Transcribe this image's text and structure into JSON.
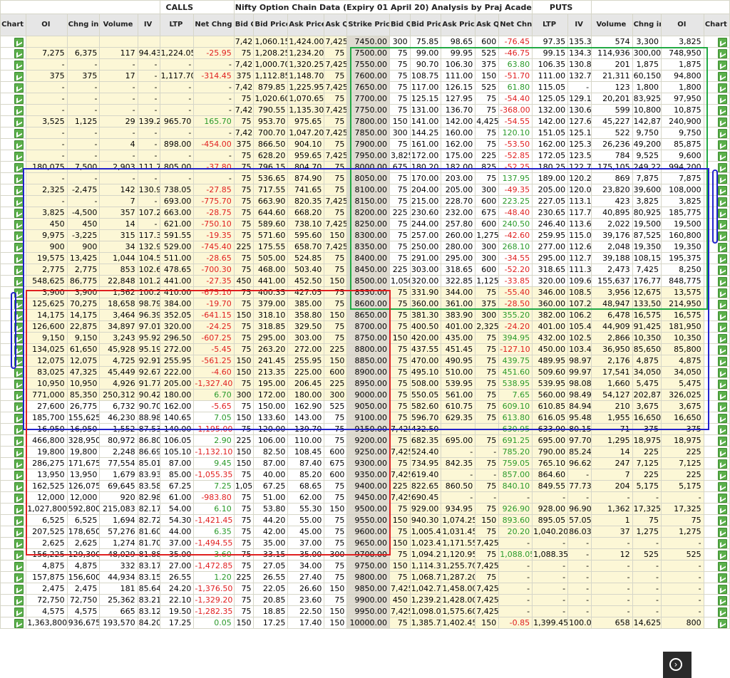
{
  "header": {
    "calls_label": "CALLS",
    "puts_label": "PUTS",
    "title": "Nifty Option Chain Data (Expiry 01 April 20) Analysis by Praj Academy EOD 27 03 2020"
  },
  "columns": [
    "Chart",
    "OI",
    "Chng in OI",
    "Volume",
    "IV",
    "LTP",
    "Net Chng",
    "Bid Qty",
    "Bid Price",
    "Ask Price",
    "Ask Qty",
    "Strike Price",
    "Bid Qty",
    "Bid Price",
    "Ask Price",
    "Ask Qty",
    "Net Chng",
    "LTP",
    "IV",
    "Volume",
    "Chng in OI",
    "OI",
    "Chart"
  ],
  "chart_icon": "chart-icon",
  "colors": {
    "itm_bg": "#fcf7d6",
    "strike_bg": "#dfdbd1",
    "negative": "#e02020",
    "positive": "#2a9a2a",
    "green_box": "#22aa44",
    "blue_box": "#2222cc",
    "red_box": "#e02020"
  },
  "rows": [
    [
      "",
      "",
      "",
      "",
      "",
      "",
      "7,425",
      "1,060.15",
      "1,424.00",
      "7,425",
      "7450.00",
      "300",
      "75.85",
      "98.65",
      "600",
      "-76.45",
      "97.35",
      "135.31",
      "574",
      "3,300",
      "3,825"
    ],
    [
      "7,275",
      "6,375",
      "117",
      "94.43",
      "1,224.05",
      "-25.95",
      "75",
      "1,208.25",
      "1,234.20",
      "75",
      "7500.00",
      "75",
      "99.00",
      "99.95",
      "525",
      "-46.75",
      "99.15",
      "134.30",
      "114,936",
      "300,000",
      "748,950"
    ],
    [
      "-",
      "-",
      "-",
      "-",
      "-",
      "-",
      "7,425",
      "1,000.70",
      "1,320.25",
      "7,425",
      "7550.00",
      "75",
      "90.70",
      "106.30",
      "375",
      "63.80",
      "106.35",
      "130.83",
      "201",
      "1,875",
      "1,875"
    ],
    [
      "375",
      "375",
      "17",
      "-",
      "1,117.70",
      "-314.45",
      "375",
      "1,112.85",
      "1,148.70",
      "75",
      "7600.00",
      "75",
      "108.75",
      "111.00",
      "150",
      "-51.70",
      "111.00",
      "132.72",
      "21,311",
      "60,150",
      "94,800"
    ],
    [
      "-",
      "-",
      "-",
      "-",
      "-",
      "-",
      "7,425",
      "879.85",
      "1,225.95",
      "7,425",
      "7650.00",
      "75",
      "117.00",
      "126.15",
      "525",
      "61.80",
      "115.05",
      "-",
      "123",
      "1,800",
      "1,800"
    ],
    [
      "-",
      "-",
      "-",
      "-",
      "-",
      "-",
      "75",
      "1,020.60",
      "1,070.65",
      "75",
      "7700.00",
      "75",
      "125.15",
      "127.95",
      "75",
      "-54.40",
      "125.05",
      "129.17",
      "20,201",
      "83,925",
      "97,950"
    ],
    [
      "-",
      "-",
      "-",
      "-",
      "-",
      "-",
      "7,425",
      "790.55",
      "1,135.30",
      "7,425",
      "7750.00",
      "75",
      "131.00",
      "136.70",
      "75",
      "-368.00",
      "132.00",
      "130.61",
      "599",
      "10,800",
      "10,875"
    ],
    [
      "3,525",
      "1,125",
      "29",
      "139.28",
      "965.70",
      "165.70",
      "75",
      "953.70",
      "975.65",
      "75",
      "7800.00",
      "150",
      "141.00",
      "142.00",
      "4,425",
      "-54.55",
      "142.00",
      "127.68",
      "45,227",
      "142,875",
      "240,900"
    ],
    [
      "-",
      "-",
      "-",
      "-",
      "-",
      "-",
      "7,425",
      "700.70",
      "1,047.20",
      "7,425",
      "7850.00",
      "300",
      "144.25",
      "160.00",
      "75",
      "120.10",
      "151.05",
      "125.13",
      "522",
      "9,750",
      "9,750"
    ],
    [
      "-",
      "-",
      "4",
      "-",
      "898.00",
      "-454.00",
      "375",
      "866.50",
      "904.10",
      "75",
      "7900.00",
      "75",
      "161.00",
      "162.00",
      "75",
      "-53.50",
      "162.00",
      "125.32",
      "26,236",
      "49,200",
      "85,875"
    ],
    [
      "-",
      "-",
      "-",
      "-",
      "-",
      "-",
      "75",
      "628.20",
      "959.65",
      "7,425",
      "7950.00",
      "3,825",
      "172.00",
      "175.00",
      "225",
      "-52.85",
      "172.05",
      "123.58",
      "784",
      "9,525",
      "9,600"
    ],
    [
      "180,075",
      "7,500",
      "2,903",
      "111.75",
      "805.00",
      "-37.80",
      "75",
      "796.15",
      "804.70",
      "75",
      "8000.00",
      "675",
      "180.20",
      "182.00",
      "825",
      "-52.25",
      "180.25",
      "122.71",
      "175,105",
      "249,225",
      "994,200"
    ],
    [
      "-",
      "-",
      "-",
      "-",
      "-",
      "-",
      "75",
      "536.65",
      "874.90",
      "75",
      "8050.00",
      "75",
      "170.00",
      "203.00",
      "75",
      "137.95",
      "189.00",
      "120.26",
      "869",
      "7,875",
      "7,875"
    ],
    [
      "2,325",
      "-2,475",
      "142",
      "130.99",
      "738.05",
      "-27.85",
      "75",
      "717.55",
      "741.65",
      "75",
      "8100.00",
      "75",
      "204.00",
      "205.00",
      "300",
      "-49.35",
      "205.00",
      "120.00",
      "23,820",
      "39,600",
      "108,000"
    ],
    [
      "-",
      "-",
      "7",
      "-",
      "693.00",
      "-775.70",
      "75",
      "663.90",
      "820.35",
      "7,425",
      "8150.00",
      "75",
      "215.00",
      "228.70",
      "600",
      "223.25",
      "227.05",
      "113.16",
      "423",
      "3,825",
      "3,825"
    ],
    [
      "3,825",
      "-4,500",
      "357",
      "107.20",
      "663.00",
      "-28.75",
      "75",
      "644.60",
      "668.20",
      "75",
      "8200.00",
      "225",
      "230.60",
      "232.00",
      "675",
      "-48.40",
      "230.65",
      "117.73",
      "40,895",
      "80,925",
      "185,775"
    ],
    [
      "450",
      "450",
      "14",
      "-",
      "621.00",
      "-750.10",
      "75",
      "589.60",
      "738.10",
      "7,425",
      "8250.00",
      "75",
      "244.00",
      "257.80",
      "600",
      "240.50",
      "246.40",
      "113.65",
      "2,022",
      "19,500",
      "19,500"
    ],
    [
      "9,975",
      "-3,225",
      "315",
      "117.38",
      "591.55",
      "-19.35",
      "75",
      "571.60",
      "595.60",
      "150",
      "8300.00",
      "75",
      "257.00",
      "260.00",
      "1,275",
      "-42.60",
      "259.95",
      "115.04",
      "39,176",
      "87,525",
      "160,800"
    ],
    [
      "900",
      "900",
      "34",
      "132.90",
      "529.00",
      "-745.40",
      "225",
      "175.55",
      "658.70",
      "7,425",
      "8350.00",
      "75",
      "250.00",
      "280.00",
      "300",
      "268.10",
      "277.00",
      "112.64",
      "2,048",
      "19,350",
      "19,350"
    ],
    [
      "19,575",
      "13,425",
      "1,044",
      "104.58",
      "511.00",
      "-28.65",
      "75",
      "505.00",
      "524.85",
      "75",
      "8400.00",
      "75",
      "291.00",
      "295.00",
      "300",
      "-34.55",
      "295.00",
      "112.78",
      "39,188",
      "108,150",
      "195,375"
    ],
    [
      "2,775",
      "2,775",
      "853",
      "102.67",
      "478.65",
      "-700.30",
      "75",
      "468.00",
      "503.40",
      "75",
      "8450.00",
      "225",
      "303.00",
      "318.65",
      "600",
      "-52.20",
      "318.65",
      "111.31",
      "2,473",
      "7,425",
      "8,250"
    ],
    [
      "548,625",
      "86,775",
      "22,848",
      "101.25",
      "441.00",
      "-27.35",
      "450",
      "441.00",
      "452.50",
      "150",
      "8500.00",
      "1,050",
      "320.00",
      "322.85",
      "1,125",
      "-33.85",
      "320.00",
      "109.66",
      "155,637",
      "176,775",
      "848,775"
    ],
    [
      "3,900",
      "3,900",
      "1,562",
      "100.25",
      "410.00",
      "-675.10",
      "75",
      "400.35",
      "427.05",
      "75",
      "8550.00",
      "75",
      "331.90",
      "344.00",
      "75",
      "-55.40",
      "346.00",
      "108.52",
      "3,956",
      "12,675",
      "13,575"
    ],
    [
      "125,625",
      "70,275",
      "18,658",
      "98.79",
      "384.00",
      "-19.70",
      "75",
      "379.00",
      "385.00",
      "75",
      "8600.00",
      "75",
      "360.00",
      "361.00",
      "375",
      "-28.50",
      "360.00",
      "107.28",
      "48,947",
      "133,500",
      "214,950"
    ],
    [
      "14,175",
      "14,175",
      "3,464",
      "96.39",
      "352.05",
      "-641.15",
      "150",
      "318.10",
      "358.80",
      "150",
      "8650.00",
      "75",
      "381.30",
      "383.90",
      "300",
      "355.20",
      "382.00",
      "106.27",
      "6,478",
      "16,575",
      "16,575"
    ],
    [
      "126,600",
      "22,875",
      "34,897",
      "97.01",
      "320.00",
      "-24.25",
      "75",
      "318.85",
      "329.50",
      "75",
      "8700.00",
      "75",
      "400.50",
      "401.00",
      "2,325",
      "-24.20",
      "401.00",
      "105.46",
      "44,909",
      "91,425",
      "181,950"
    ],
    [
      "9,150",
      "9,150",
      "3,243",
      "95.92",
      "296.50",
      "-607.25",
      "75",
      "295.00",
      "303.00",
      "75",
      "8750.00",
      "150",
      "420.00",
      "435.00",
      "75",
      "394.95",
      "432.00",
      "102.51",
      "2,866",
      "10,350",
      "10,350"
    ],
    [
      "134,025",
      "61,650",
      "45,928",
      "95.19",
      "272.00",
      "-5.45",
      "75",
      "263.20",
      "272.00",
      "225",
      "8800.00",
      "75",
      "437.55",
      "451.45",
      "75",
      "-127.10",
      "450.00",
      "103.44",
      "36,950",
      "85,650",
      "85,800"
    ],
    [
      "12,075",
      "12,075",
      "4,725",
      "92.91",
      "255.95",
      "-561.25",
      "150",
      "241.45",
      "255.95",
      "150",
      "8850.00",
      "75",
      "470.00",
      "490.95",
      "75",
      "439.75",
      "489.95",
      "98.97",
      "2,176",
      "4,875",
      "4,875"
    ],
    [
      "83,025",
      "47,325",
      "45,449",
      "92.67",
      "222.00",
      "-4.60",
      "150",
      "213.35",
      "225.00",
      "600",
      "8900.00",
      "75",
      "495.10",
      "510.00",
      "75",
      "451.60",
      "509.60",
      "99.97",
      "17,541",
      "34,050",
      "34,050"
    ],
    [
      "10,950",
      "10,950",
      "4,926",
      "91.77",
      "205.00",
      "-1,327.40",
      "75",
      "195.00",
      "206.45",
      "225",
      "8950.00",
      "75",
      "508.00",
      "539.95",
      "75",
      "538.95",
      "539.95",
      "98.08",
      "1,660",
      "5,475",
      "5,475"
    ],
    [
      "771,000",
      "85,350",
      "250,312",
      "90.42",
      "180.00",
      "6.70",
      "300",
      "172.00",
      "180.00",
      "300",
      "9000.00",
      "75",
      "550.05",
      "561.00",
      "75",
      "7.65",
      "560.00",
      "98.49",
      "54,127",
      "202,875",
      "326,025"
    ],
    [
      "27,600",
      "26,775",
      "6,732",
      "90.70",
      "162.00",
      "-5.65",
      "75",
      "150.00",
      "162.90",
      "525",
      "9050.00",
      "75",
      "582.60",
      "610.75",
      "75",
      "609.10",
      "610.85",
      "84.94",
      "210",
      "3,675",
      "3,675"
    ],
    [
      "185,700",
      "155,625",
      "46,230",
      "88.98",
      "140.65",
      "7.05",
      "150",
      "133.60",
      "143.00",
      "75",
      "9100.00",
      "75",
      "596.70",
      "629.35",
      "75",
      "613.80",
      "616.05",
      "95.48",
      "1,955",
      "16,650",
      "16,650"
    ],
    [
      "16,950",
      "16,950",
      "1,552",
      "87.53",
      "140.00",
      "-1,195.00",
      "75",
      "120.00",
      "139.70",
      "75",
      "9150.00",
      "7,425",
      "432.50",
      "-",
      "-",
      "630.95",
      "633.90",
      "80.15",
      "71",
      "375",
      "375"
    ],
    [
      "466,800",
      "328,950",
      "80,972",
      "86.80",
      "106.05",
      "2.90",
      "225",
      "106.00",
      "110.00",
      "75",
      "9200.00",
      "75",
      "682.35",
      "695.00",
      "75",
      "691.25",
      "695.00",
      "97.70",
      "1,295",
      "18,975",
      "18,975"
    ],
    [
      "19,800",
      "19,800",
      "2,248",
      "86.69",
      "105.10",
      "-1,132.10",
      "150",
      "82.50",
      "108.45",
      "600",
      "9250.00",
      "7,425",
      "524.40",
      "-",
      "-",
      "785.20",
      "790.00",
      "85.24",
      "14",
      "225",
      "225"
    ],
    [
      "286,275",
      "171,675",
      "77,554",
      "85.01",
      "87.00",
      "9.45",
      "150",
      "87.00",
      "87.40",
      "675",
      "9300.00",
      "75",
      "734.95",
      "842.35",
      "75",
      "759.05",
      "765.10",
      "96.62",
      "247",
      "7,125",
      "7,125"
    ],
    [
      "13,950",
      "13,950",
      "1,679",
      "83.93",
      "85.00",
      "-1,055.35",
      "75",
      "40.00",
      "85.20",
      "600",
      "9350.00",
      "7,425",
      "619.40",
      "-",
      "-",
      "857.00",
      "864.60",
      "-",
      "7",
      "225",
      "225"
    ],
    [
      "162,525",
      "126,075",
      "69,645",
      "83.58",
      "67.25",
      "7.25",
      "1,050",
      "67.25",
      "68.65",
      "75",
      "9400.00",
      "225",
      "822.65",
      "860.50",
      "75",
      "840.10",
      "849.55",
      "77.73",
      "204",
      "5,175",
      "5,175"
    ],
    [
      "12,000",
      "12,000",
      "920",
      "82.98",
      "61.00",
      "-983.80",
      "75",
      "51.00",
      "62.00",
      "75",
      "9450.00",
      "7,425",
      "690.45",
      "-",
      "-",
      "-",
      "-",
      "-",
      "-",
      "-",
      "-"
    ],
    [
      "1,027,800",
      "592,800",
      "215,083",
      "82.17",
      "54.00",
      "6.10",
      "75",
      "53.80",
      "55.30",
      "150",
      "9500.00",
      "75",
      "929.00",
      "934.95",
      "75",
      "926.90",
      "928.00",
      "96.90",
      "1,362",
      "17,325",
      "17,325"
    ],
    [
      "6,525",
      "6,525",
      "1,694",
      "82.72",
      "54.30",
      "-1,421.45",
      "75",
      "44.20",
      "55.00",
      "75",
      "9550.00",
      "150",
      "940.30",
      "1,074.25",
      "150",
      "893.60",
      "895.05",
      "57.05",
      "1",
      "75",
      "75"
    ],
    [
      "207,525",
      "178,650",
      "57,276",
      "81.60",
      "44.00",
      "6.35",
      "75",
      "42.00",
      "45.00",
      "75",
      "9600.00",
      "75",
      "1,005.40",
      "1,031.45",
      "75",
      "20.20",
      "1,040.20",
      "86.03",
      "37",
      "1,275",
      "1,275"
    ],
    [
      "2,625",
      "2,625",
      "1,274",
      "81.70",
      "37.00",
      "-1,494.55",
      "75",
      "35.00",
      "37.00",
      "75",
      "9650.00",
      "150",
      "1,023.45",
      "1,171.55",
      "7,425",
      "-",
      "-",
      "-",
      "-",
      "-",
      "-"
    ],
    [
      "156,225",
      "129,300",
      "48,029",
      "81.88",
      "35.00",
      "3.60",
      "75",
      "33.15",
      "35.00",
      "300",
      "9700.00",
      "75",
      "1,094.20",
      "1,120.95",
      "75",
      "1,088.05",
      "1,088.35",
      "-",
      "12",
      "525",
      "525"
    ],
    [
      "4,875",
      "4,875",
      "332",
      "83.17",
      "27.00",
      "-1,472.85",
      "75",
      "27.05",
      "34.00",
      "75",
      "9750.00",
      "150",
      "1,114.35",
      "1,255.70",
      "7,425",
      "-",
      "-",
      "-",
      "-",
      "-",
      "-"
    ],
    [
      "157,875",
      "156,600",
      "44,934",
      "83.15",
      "26.55",
      "1.20",
      "225",
      "26.55",
      "27.40",
      "75",
      "9800.00",
      "75",
      "1,068.75",
      "1,287.20",
      "75",
      "-",
      "-",
      "-",
      "-",
      "-",
      "-"
    ],
    [
      "2,475",
      "2,475",
      "181",
      "85.64",
      "24.20",
      "-1,376.50",
      "75",
      "22.05",
      "26.60",
      "150",
      "9850.00",
      "7,425",
      "1,042.70",
      "1,458.00",
      "7,425",
      "-",
      "-",
      "-",
      "-",
      "-",
      "-"
    ],
    [
      "72,750",
      "72,750",
      "25,362",
      "83.21",
      "22.10",
      "-1,329.20",
      "75",
      "20.85",
      "23.60",
      "75",
      "9900.00",
      "450",
      "1,239.20",
      "1,428.00",
      "7,425",
      "-",
      "-",
      "-",
      "-",
      "-",
      "-"
    ],
    [
      "4,575",
      "4,575",
      "665",
      "83.12",
      "19.50",
      "-1,282.35",
      "75",
      "18.85",
      "22.50",
      "150",
      "9950.00",
      "7,425",
      "1,098.05",
      "1,575.60",
      "7,425",
      "-",
      "-",
      "-",
      "-",
      "-",
      "-"
    ],
    [
      "1,363,800",
      "936,675",
      "193,570",
      "84.20",
      "17.25",
      "0.05",
      "150",
      "17.25",
      "17.40",
      "150",
      "10000.00",
      "75",
      "1,385.75",
      "1,402.45",
      "150",
      "-0.85",
      "1,399.45",
      "100.07",
      "658",
      "14,625",
      "800"
    ]
  ],
  "itm_calls_through": "9000.00",
  "itm_puts_from": "8550.00",
  "nav_icon": "next-arrow-icon"
}
